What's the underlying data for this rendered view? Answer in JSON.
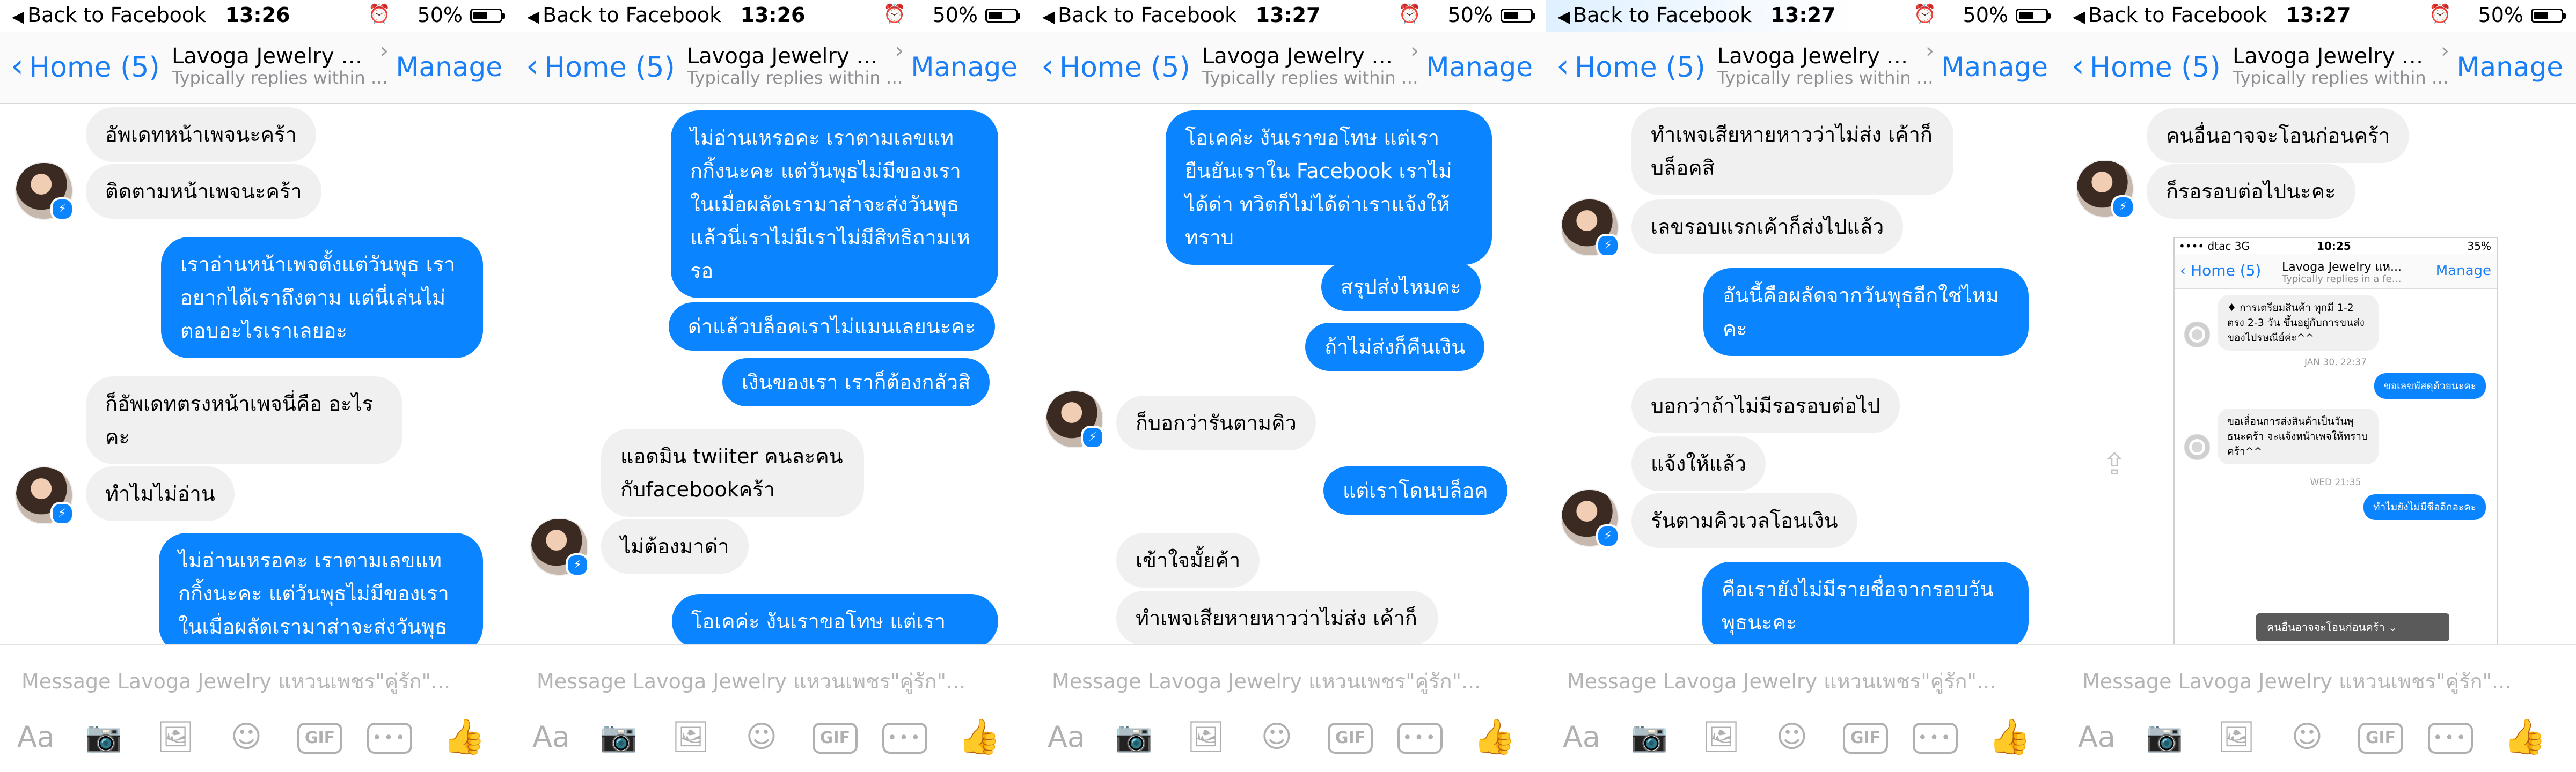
{
  "status": {
    "back_label": "Back to Facebook",
    "battery_pct": "50%",
    "battery_fill": 0.5,
    "times": [
      "13:26",
      "13:26",
      "13:27",
      "13:27",
      "13:27"
    ]
  },
  "nav": {
    "home_label": "Home (5)",
    "title": "Lavoga Jewelry แห...",
    "subtitle": "Typically replies within a...",
    "manage_label": "Manage"
  },
  "composer": {
    "placeholder": "Message Lavoga Jewelry แหวนเพชร\"คู่รัก\"...",
    "aa": "Aa",
    "gif": "GIF",
    "more": "•••"
  },
  "icons": {
    "camera": "camera-icon",
    "gallery": "gallery-icon",
    "emoji": "emoji-icon",
    "like": "thumbs-up-icon"
  },
  "colors": {
    "accent": "#1a7ef5",
    "outgoing_bubble": "#0a84ff",
    "incoming_bubble": "#f1f0f0"
  },
  "panels": [
    {
      "messages": [
        {
          "from": "in",
          "text": "อัพเดทหน้าเพจนะคร้า"
        },
        {
          "from": "in",
          "text": "ติดตามหน้าเพจนะคร้า"
        },
        {
          "from": "out",
          "text": "เราอ่านหน้าเพจตั้งแต่วันพุธ เราอยากได้เราถึงตาม แต่นี่เล่นไม่ตอบอะไรเราเลยอะ"
        },
        {
          "from": "in",
          "text": "ก็อัพเดทตรงหน้าเพจนี่คือ อะไรคะ"
        },
        {
          "from": "in",
          "text": "ทำไมไม่อ่าน"
        },
        {
          "from": "out",
          "text": "ไม่อ่านเหรอคะ เราตามเลขแทกกิ้งนะคะ แต่วันพุธไม่มีของเราในเมื่อผลัดเรามาส่าจะส่งวันพุธ"
        }
      ]
    },
    {
      "messages": [
        {
          "from": "out",
          "text": "ไม่อ่านเหรอคะ เราตามเลขแทกกิ้งนะคะ แต่วันพุธไม่มีของเราในเมื่อผลัดเรามาส่าจะส่งวันพุธแล้วนี่เราไม่มีเราไม่มีสิทธิถามเหรอ"
        },
        {
          "from": "out",
          "text": "ด่าแล้วบล็อคเราไม่แมนเลยนะคะ"
        },
        {
          "from": "out",
          "text": "เงินของเรา เราก็ต้องกลัวสิ"
        },
        {
          "from": "in",
          "text": "แอดมิน twiiter คนละคนกับfacebookคร้า"
        },
        {
          "from": "in",
          "text": "ไม่ต้องมาด่า"
        },
        {
          "from": "out",
          "text": "โอเคค่ะ งันเราขอโทษ แต่เรา"
        }
      ]
    },
    {
      "messages": [
        {
          "from": "out",
          "text": "โอเคค่ะ งันเราขอโทษ แต่เรายืนยันเราใน Facebook เราไม่ได้ด่า ทวิตก็ไม่ได้ด่าเราแจ้งให้ทราบ"
        },
        {
          "from": "out",
          "text": "สรุปส่งไหมคะ"
        },
        {
          "from": "out",
          "text": "ถ้าไม่ส่งก็คืนเงิน"
        },
        {
          "from": "in",
          "text": "ก็บอกว่ารันตามคิว"
        },
        {
          "from": "out",
          "text": "แต่เราโดนบล็อค"
        },
        {
          "from": "in",
          "text": "เข้าใจมั้ยค้า"
        },
        {
          "from": "in",
          "text": "ทำเพจเสียหายหาวว่าไม่ส่ง เค้าก็"
        }
      ]
    },
    {
      "messages": [
        {
          "from": "in",
          "text": "ทำเพจเสียหายหาวว่าไม่ส่ง เค้าก็บล็อคสิ"
        },
        {
          "from": "in",
          "text": "เลขรอบแรกเค้าก็ส่งไปแล้ว"
        },
        {
          "from": "out",
          "text": "อันนี้คือผลัดจากวันพุธอีกใช่ไหมคะ"
        },
        {
          "from": "in",
          "text": "บอกว่าถ้าไม่มีรอรอบต่อไป"
        },
        {
          "from": "in",
          "text": "แจ้งให้แล้ว"
        },
        {
          "from": "in",
          "text": "รันตามคิวเวลโอนเงิน"
        },
        {
          "from": "out",
          "text": "คือเรายังไม่มีรายชื่อจากรอบวันพุธนะคะ"
        }
      ]
    },
    {
      "messages": [
        {
          "from": "in",
          "text": "คนอื่นอาจจะโอนก่อนคร้า"
        },
        {
          "from": "in",
          "text": "ก็รอรอบต่อไปนะคะ"
        }
      ],
      "nested": {
        "carrier": "•••• dtac  3G",
        "time": "10:25",
        "battery": "35%",
        "home_label": "Home (5)",
        "title": "Lavoga Jewelry แห...",
        "subtitle": "Typically replies in a few...",
        "manage_label": "Manage",
        "msg1": "♦ การเตรียมสินค้า ทุกมี 1-2 ตรง 2-3 วัน ขึ้นอยู่กับการขนส่งของไปรษณีย์ค่ะ^^",
        "ts1": "JAN 30, 22:37",
        "msg2": "ขอเลขพัสดุด้วยนะคะ",
        "msg3": "ขอเลื่อนการส่งสินค้าเป็นวันพุธนะคร้า จะแจ้งหน้าเพจให้ทราบคร้า^^",
        "ts2": "WED 21:35",
        "msg4": "ทำไมยังไม่มีชื่ออีกอะคะ",
        "tooltip": "คนอื่นอาจจะโอนก่อนคร้า"
      }
    }
  ]
}
